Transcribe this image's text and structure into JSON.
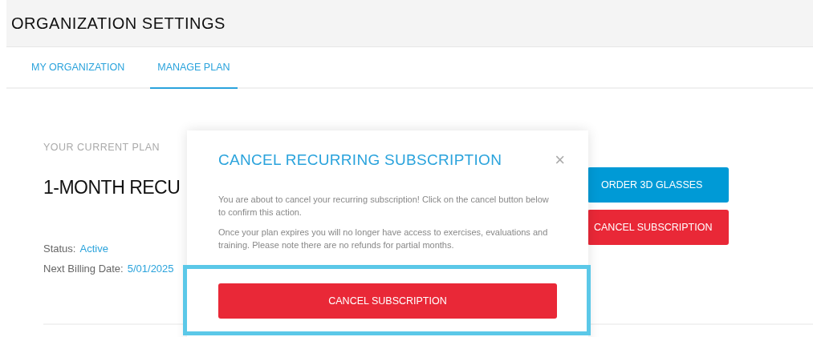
{
  "header": {
    "title": "ORGANIZATION SETTINGS"
  },
  "tabs": [
    {
      "label": "MY ORGANIZATION",
      "selected": false
    },
    {
      "label": "MANAGE PLAN",
      "selected": true
    }
  ],
  "plan": {
    "caption": "YOUR CURRENT PLAN",
    "name": "1-MONTH RECU",
    "status_label": "Status:",
    "status_value": "Active",
    "billing_label": "Next Billing Date:",
    "billing_value": "5/01/2025"
  },
  "actions": [
    {
      "label": "ORDER 3D GLASSES",
      "kind": "primary"
    },
    {
      "label": "CANCEL SUBSCRIPTION",
      "kind": "danger"
    }
  ],
  "dialog": {
    "title": "CANCEL RECURRING SUBSCRIPTION",
    "close": "×",
    "paragraphs": [
      "You are about to cancel your recurring subscription! Click on the cancel button below to confirm this action.",
      "Once your plan expires you will no longer have access to exercises, evaluations and training. Please note there are no refunds for partial months."
    ],
    "button": "CANCEL SUBSCRIPTION",
    "highlighted": true
  }
}
